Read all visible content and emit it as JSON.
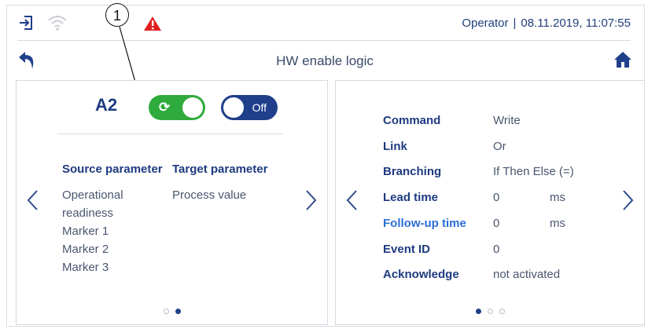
{
  "status_bar": {
    "icons": [
      "login-icon",
      "wifi-icon",
      "warning-icon"
    ],
    "user": "Operator",
    "separator": "|",
    "datetime": "08.11.2019, 11:07:55"
  },
  "title_bar": {
    "title": "HW enable logic",
    "back_icon": "back-arrow-icon",
    "home_icon": "home-icon"
  },
  "callout": {
    "number": "1"
  },
  "left_panel": {
    "device": "A2",
    "toggle_enabled": {
      "state": "on",
      "icon": "refresh-icon"
    },
    "toggle_off": {
      "label": "Off",
      "state": "off"
    },
    "source_header": "Source parameter",
    "target_header": "Target parameter",
    "source_items": [
      "Operational",
      "readiness",
      "Marker 1",
      "Marker 2",
      "Marker 3"
    ],
    "target_items": [
      "Process value"
    ],
    "page_dots": {
      "total": 2,
      "active": 2
    }
  },
  "right_panel": {
    "rows": [
      {
        "key": "Command",
        "value": "Write",
        "unit": "",
        "highlight": false
      },
      {
        "key": "Link",
        "value": "Or",
        "unit": "",
        "highlight": false
      },
      {
        "key": "Branching",
        "value": "If Then Else (=)",
        "unit": "",
        "highlight": false
      },
      {
        "key": "Lead time",
        "value": "0",
        "unit": "ms",
        "highlight": false
      },
      {
        "key": "Follow-up time",
        "value": "0",
        "unit": "ms",
        "highlight": true
      },
      {
        "key": "Event ID",
        "value": "0",
        "unit": "",
        "highlight": false
      },
      {
        "key": "Acknowledge",
        "value": "not activated",
        "unit": "",
        "highlight": false
      }
    ],
    "page_dots": {
      "total": 3,
      "active": 1
    }
  },
  "colors": {
    "accent": "#1f3f8a",
    "toggle_on": "#2faa3c",
    "warning": "#e02020",
    "highlight_key": "#2a6ed6"
  }
}
